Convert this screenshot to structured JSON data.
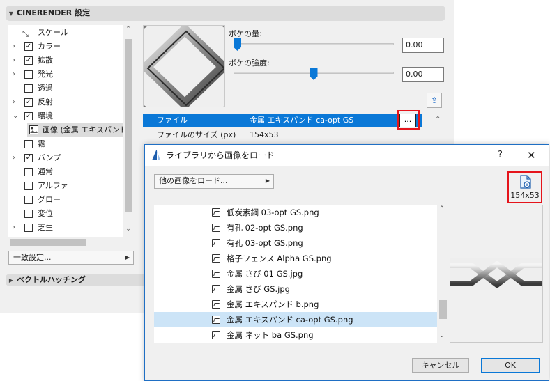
{
  "panel": {
    "title": "CINERENDER 設定",
    "tree": [
      {
        "label": "スケール",
        "chevron": "",
        "checkbox": "icon"
      },
      {
        "label": "カラー",
        "chevron": "›",
        "checkbox": "✓"
      },
      {
        "label": "拡散",
        "chevron": "›",
        "checkbox": "✓"
      },
      {
        "label": "発光",
        "chevron": "›",
        "checkbox": ""
      },
      {
        "label": "透過",
        "chevron": "",
        "checkbox": ""
      },
      {
        "label": "反射",
        "chevron": "›",
        "checkbox": "✓"
      },
      {
        "label": "環境",
        "chevron": "⌄",
        "checkbox": "✓"
      },
      {
        "label": "画像 (金属 エキスパンド c",
        "chevron": "",
        "checkbox": "image"
      },
      {
        "label": "霧",
        "chevron": "",
        "checkbox": ""
      },
      {
        "label": "バンプ",
        "chevron": "›",
        "checkbox": "✓"
      },
      {
        "label": "通常",
        "chevron": "",
        "checkbox": ""
      },
      {
        "label": "アルファ",
        "chevron": "",
        "checkbox": ""
      },
      {
        "label": "グロー",
        "chevron": "",
        "checkbox": ""
      },
      {
        "label": "変位",
        "chevron": "",
        "checkbox": ""
      },
      {
        "label": "芝生",
        "chevron": "›",
        "checkbox": ""
      }
    ],
    "preset_dropdown": "一致設定...",
    "vector_hatching": "ベクトルハッチング",
    "bokeh_amount_label": "ボケの量:",
    "bokeh_amount_value": "0.00",
    "bokeh_amount_level": 0.0,
    "bokeh_strength_label": "ボケの強度:",
    "bokeh_strength_value": "0.00",
    "bokeh_strength_level": 0.5,
    "file_label": "ファイル",
    "file_value": "金属 エキスパンド ca-opt GS",
    "browse_label": "...",
    "size_label": "ファイルのサイズ (px)",
    "size_value": "154x53"
  },
  "dialog": {
    "title": "ライブラリから画像をロード",
    "help": "?",
    "close": "✕",
    "other_images_button": "他の画像をロード...",
    "image_size": "154x53",
    "files": [
      "低炭素鋼 03-opt GS.png",
      "有孔 02-opt GS.png",
      "有孔 03-opt GS.png",
      "格子フェンス Alpha GS.png",
      "金属 さび 01 GS.jpg",
      "金属 さび GS.jpg",
      "金属 エキスパンド b.png",
      "金属 エキスパンド ca-opt GS.png",
      "金属 ネット ba GS.png"
    ],
    "selected_index": 7,
    "cancel_label": "キャンセル",
    "ok_label": "OK"
  },
  "colors": {
    "accent": "#0a78d7",
    "highlight_box": "#e5141b",
    "list_selection": "#cce4f7"
  }
}
